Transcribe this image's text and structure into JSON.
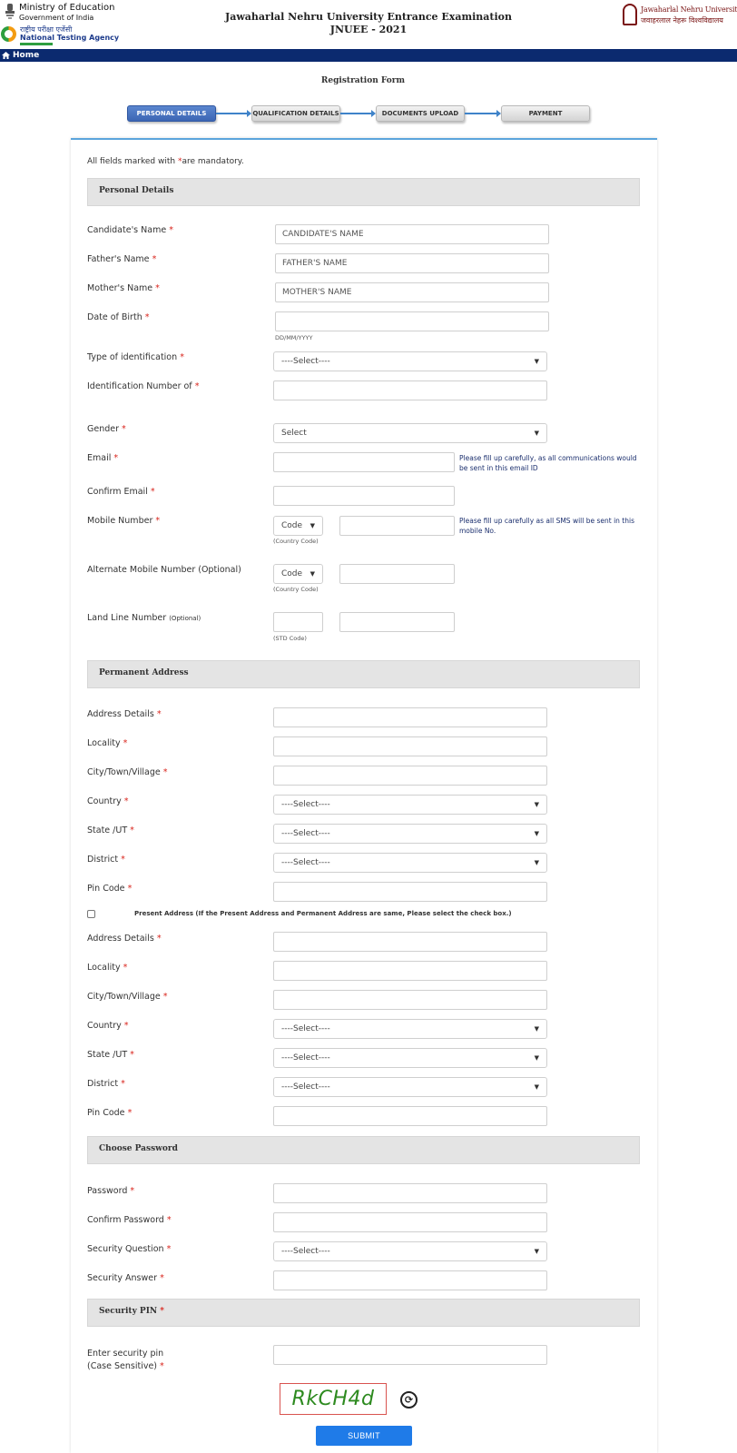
{
  "header": {
    "ministry_title": "Ministry of Education",
    "ministry_subtitle": "Government of India",
    "nta_hindi": "राष्ट्रीय परीक्षा एजेंसी",
    "nta_name": "National Testing Agency",
    "site_title_line1": "Jawaharlal Nehru University Entrance Examination",
    "site_title_line2": "JNUEE - 2021",
    "jnu_name": "Jawaharlal Nehru University",
    "jnu_hindi": "जवाहरलाल नेहरू विश्वविद्यालय"
  },
  "nav": {
    "home_label": "Home"
  },
  "form": {
    "title": "Registration Form",
    "steps": [
      "PERSONAL DETAILS",
      "QUALIFICATION DETAILS",
      "DOCUMENTS UPLOAD",
      "PAYMENT"
    ],
    "active_step": 0,
    "mandatory_note": "All fields marked with ",
    "mandatory_note_star": "*",
    "mandatory_note_end": "are mandatory."
  },
  "personal": {
    "section_title": "Personal Details",
    "candidate_name_label": "Candidate's Name",
    "candidate_name_placeholder": "CANDIDATE'S NAME",
    "father_name_label": "Father's Name",
    "father_name_placeholder": "FATHER'S NAME",
    "mother_name_label": "Mother's Name",
    "mother_name_placeholder": "MOTHER'S NAME",
    "dob_label": "Date of Birth",
    "dob_hint": "DD/MM/YYYY",
    "id_type_label": "Type of identification",
    "id_type_value": "----Select----",
    "id_number_label": "Identification Number of",
    "gender_label": "Gender",
    "gender_value": "Select",
    "email_label": "Email",
    "email_help": "Please fill up carefully, as all communications would be sent in this email ID",
    "confirm_email_label": "Confirm Email",
    "mobile_label": "Mobile Number",
    "mobile_code_value": "Code",
    "country_code_hint": "(Country Code)",
    "mobile_help": "Please fill up carefully as all SMS will be sent in this mobile No.",
    "alt_mobile_label": "Alternate Mobile Number (Optional)",
    "alt_code_value": "Code",
    "landline_label": "Land Line Number",
    "landline_optional": "(Optional)",
    "std_code_hint": "(STD Code)"
  },
  "permanent": {
    "section_title": "Permanent Address",
    "address_label": "Address Details",
    "locality_label": "Locality",
    "city_label": "City/Town/Village",
    "country_label": "Country",
    "country_value": "----Select----",
    "state_label": "State /UT",
    "state_value": "----Select----",
    "district_label": "District",
    "district_value": "----Select----",
    "pin_label": "Pin Code"
  },
  "present": {
    "same_checkbox_label": "Present Address (If the Present Address and Permanent Address are same, Please select the check box.)",
    "same_checked": false,
    "address_label": "Address Details",
    "locality_label": "Locality",
    "city_label": "City/Town/Village",
    "country_label": "Country",
    "country_value": "----Select----",
    "state_label": "State /UT",
    "state_value": "----Select----",
    "district_label": "District",
    "district_value": "----Select----",
    "pin_label": "Pin Code"
  },
  "password": {
    "section_title": "Choose Password",
    "password_label": "Password",
    "confirm_label": "Confirm Password",
    "question_label": "Security Question",
    "question_value": "----Select----",
    "answer_label": "Security Answer"
  },
  "security": {
    "section_title": "Security PIN",
    "pin_label_line1": "Enter security pin",
    "pin_label_line2": "(Case Sensitive)",
    "captcha_text": "RkCH4d",
    "submit_label": "SUBMIT"
  },
  "colors": {
    "navbar": "#0b2a6f",
    "accent": "#1f7be8",
    "required": "#d9251d",
    "captcha_text": "#2d8a1f"
  }
}
